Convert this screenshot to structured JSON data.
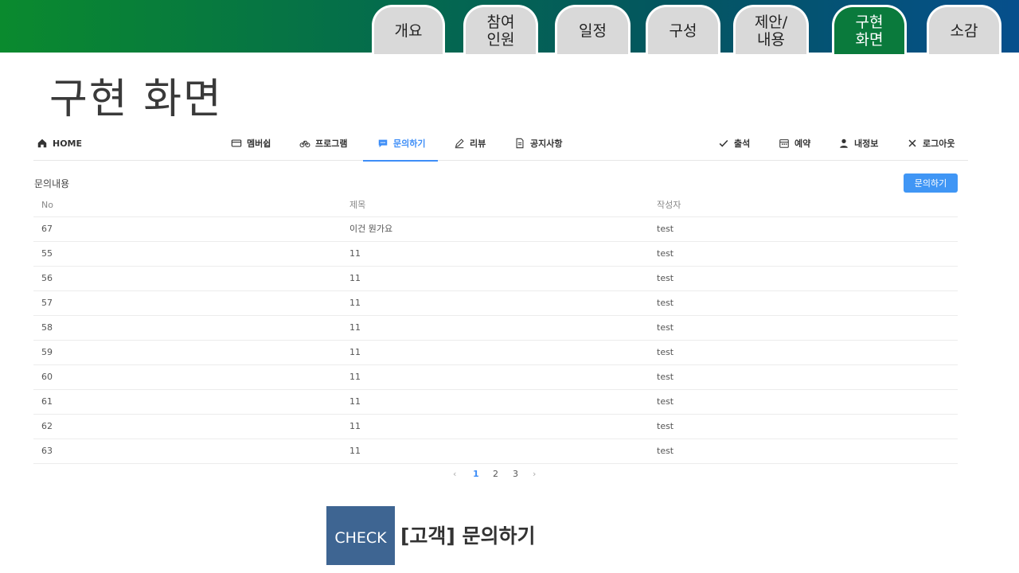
{
  "slide_tabs": [
    {
      "label": "개요"
    },
    {
      "label": "참여\n인원"
    },
    {
      "label": "일정"
    },
    {
      "label": "구성"
    },
    {
      "label": "제안/\n내용"
    },
    {
      "label": "구현\n화면"
    },
    {
      "label": "소감"
    }
  ],
  "slide_title": "구현 화면",
  "app_nav": {
    "home": "HOME",
    "membership": "멤버쉽",
    "program": "프로그램",
    "inquiry": "문의하기",
    "review": "리뷰",
    "notice": "공지사항",
    "attendance": "출석",
    "reservation": "예약",
    "my_info": "내정보",
    "logout": "로그아웃"
  },
  "section_label": "문의내용",
  "inquiry_button": "문의하기",
  "table": {
    "headers": [
      "No",
      "제목",
      "작성자"
    ],
    "rows": [
      [
        "67",
        "이건 뭔가요",
        "test"
      ],
      [
        "55",
        "11",
        "test"
      ],
      [
        "56",
        "11",
        "test"
      ],
      [
        "57",
        "11",
        "test"
      ],
      [
        "58",
        "11",
        "test"
      ],
      [
        "59",
        "11",
        "test"
      ],
      [
        "60",
        "11",
        "test"
      ],
      [
        "61",
        "11",
        "test"
      ],
      [
        "62",
        "11",
        "test"
      ],
      [
        "63",
        "11",
        "test"
      ]
    ]
  },
  "pagination": {
    "prev": "‹",
    "pages": [
      "1",
      "2",
      "3"
    ],
    "next": "›",
    "current": "1"
  },
  "check_label": "CHECK",
  "check_caption": "[고객] 문의하기",
  "colors": {
    "accent": "#3e8ef7",
    "button": "#4096f5",
    "active_tab": "#0a7a3c",
    "check_box": "#3e6592"
  }
}
